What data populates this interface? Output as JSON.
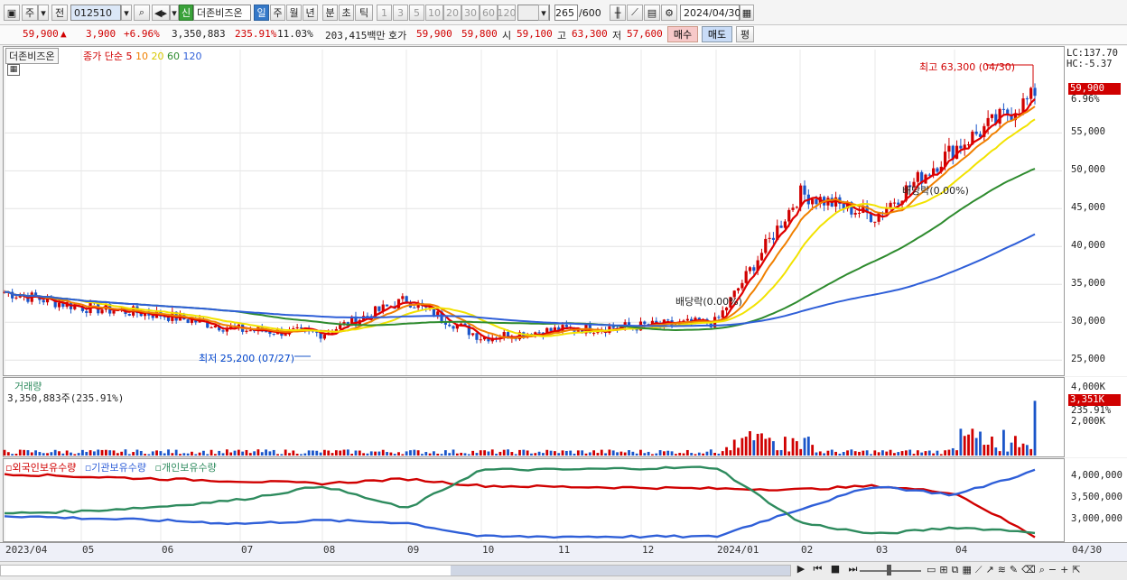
{
  "toolbar": {
    "market": "주",
    "kind": "전",
    "code": "012510",
    "name_badge": "신",
    "name": "더존비즈온",
    "periods": [
      "일",
      "주",
      "월",
      "년",
      "분",
      "초",
      "틱"
    ],
    "active_period": "일",
    "intervals": [
      "1",
      "3",
      "5",
      "10",
      "20",
      "30",
      "60",
      "120"
    ],
    "count": "265",
    "count_max": "/600",
    "date": "2024/04/30"
  },
  "quote": {
    "price": "59,900",
    "arrow": "▲",
    "change": "3,900",
    "change_pct": "+6.96%",
    "volume": "3,350,883",
    "volume_ratio": "235.91%",
    "turnover": "11.03%",
    "amount": "203,415백만",
    "bid_label": "호가",
    "ask": "59,900",
    "bid": "59,800",
    "open_label": "시",
    "open": "59,100",
    "high_label": "고",
    "high": "63,300",
    "low_label": "저",
    "low": "57,600",
    "buy_label": "매수",
    "sell_label": "매도",
    "eval_label": "평"
  },
  "price_panel": {
    "name": "더존비즈온",
    "legend_title": "종가 단순",
    "ma": [
      {
        "label": "5",
        "color": "#e00000"
      },
      {
        "label": "10",
        "color": "#f08000"
      },
      {
        "label": "20",
        "color": "#e8d800"
      },
      {
        "label": "60",
        "color": "#2e8b2e"
      },
      {
        "label": "120",
        "color": "#2f5fd8"
      }
    ],
    "lc": "LC:137.70",
    "hc": "HC:-5.37",
    "last_price": "59,900",
    "last_pct": "6.96%",
    "high_note": "최고 63,300 (04/30)",
    "low_note": "최저 25,200 (07/27)",
    "div1": "배당락(0.00%)",
    "div2": "배당락(0.00%)",
    "y_ticks": [
      "55,000",
      "50,000",
      "45,000",
      "40,000",
      "35,000",
      "30,000",
      "25,000"
    ],
    "y_range": [
      23000,
      66000
    ]
  },
  "volume_panel": {
    "title": "거래량",
    "value": "3,350,883주(235.91%)",
    "y_ticks": [
      "4,000K",
      "2,000K"
    ],
    "last": "3,351K",
    "last_pct": "235.91%"
  },
  "holding_panel": {
    "series": [
      {
        "name": "외국인보유수량",
        "color": "#d00000"
      },
      {
        "name": "기관보유수량",
        "color": "#2f5fd8"
      },
      {
        "name": "개인보유수량",
        "color": "#2e8b5e"
      }
    ],
    "y_ticks": [
      "4,000,000",
      "3,500,000",
      "3,000,000"
    ]
  },
  "x_axis": [
    "2023/04",
    "05",
    "06",
    "07",
    "08",
    "09",
    "10",
    "11",
    "12",
    "2024/01",
    "02",
    "03",
    "04",
    "04/30"
  ],
  "chart_data": {
    "type": "line",
    "x": [
      "2023/04",
      "05",
      "06",
      "07",
      "08",
      "09",
      "10",
      "11",
      "12",
      "2024/01",
      "02",
      "03",
      "04",
      "04/30"
    ],
    "series": [
      {
        "name": "종가",
        "values": [
          34000,
          32000,
          31000,
          29000,
          28500,
          33000,
          28000,
          29000,
          29500,
          30000,
          47000,
          44000,
          53000,
          59900
        ]
      },
      {
        "name": "외국인보유수량",
        "values": [
          4060000,
          4000000,
          3950000,
          3900000,
          3850000,
          3950000,
          3800000,
          3780000,
          3760000,
          3740000,
          3720000,
          3800000,
          3650000,
          2700000
        ]
      },
      {
        "name": "기관보유수량",
        "values": [
          3150000,
          3100000,
          3050000,
          2980000,
          3050000,
          3000000,
          2700000,
          2700000,
          2700000,
          2700000,
          3300000,
          3800000,
          3600000,
          4130000
        ]
      },
      {
        "name": "개인보유수량",
        "values": [
          3200000,
          3250000,
          3350000,
          3500000,
          3800000,
          3300000,
          4150000,
          4150000,
          4180000,
          4200000,
          3000000,
          2750000,
          2900000,
          2800000
        ]
      }
    ],
    "ylim": [
      23000,
      66000
    ]
  },
  "bottom": {
    "nav": [
      "▶",
      "⏮",
      "■",
      "⏭"
    ]
  }
}
